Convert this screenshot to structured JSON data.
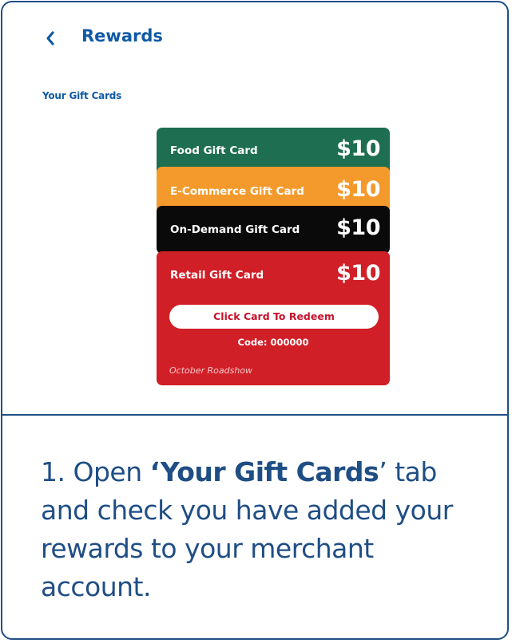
{
  "header": {
    "back_icon": "chevron-left-icon",
    "title": "Rewards"
  },
  "section": {
    "label": "Your Gift Cards"
  },
  "cards": [
    {
      "name": "Food Gift Card",
      "value": "$10",
      "color": "#1e6e52"
    },
    {
      "name": "E-Commerce Gift Card",
      "value": "$10",
      "color": "#f49a2c"
    },
    {
      "name": "On-Demand Gift Card",
      "value": "$10",
      "color": "#0a0a0a"
    },
    {
      "name": "Retail Gift Card",
      "value": "$10",
      "color": "#d11f27",
      "redeem_label": "Click Card To Redeem",
      "code": "Code: 000000",
      "campaign": "October Roadshow"
    }
  ],
  "instruction": {
    "prefix": "1. Open ",
    "quote_open": "‘",
    "highlight": "Your Gift Cards",
    "quote_close": "’",
    "suffix": " tab and check you have added your rewards to your merchant account."
  },
  "colors": {
    "brand_blue": "#1f4e85",
    "link_blue": "#0f5aa6",
    "redeem_text": "#c5132b"
  }
}
